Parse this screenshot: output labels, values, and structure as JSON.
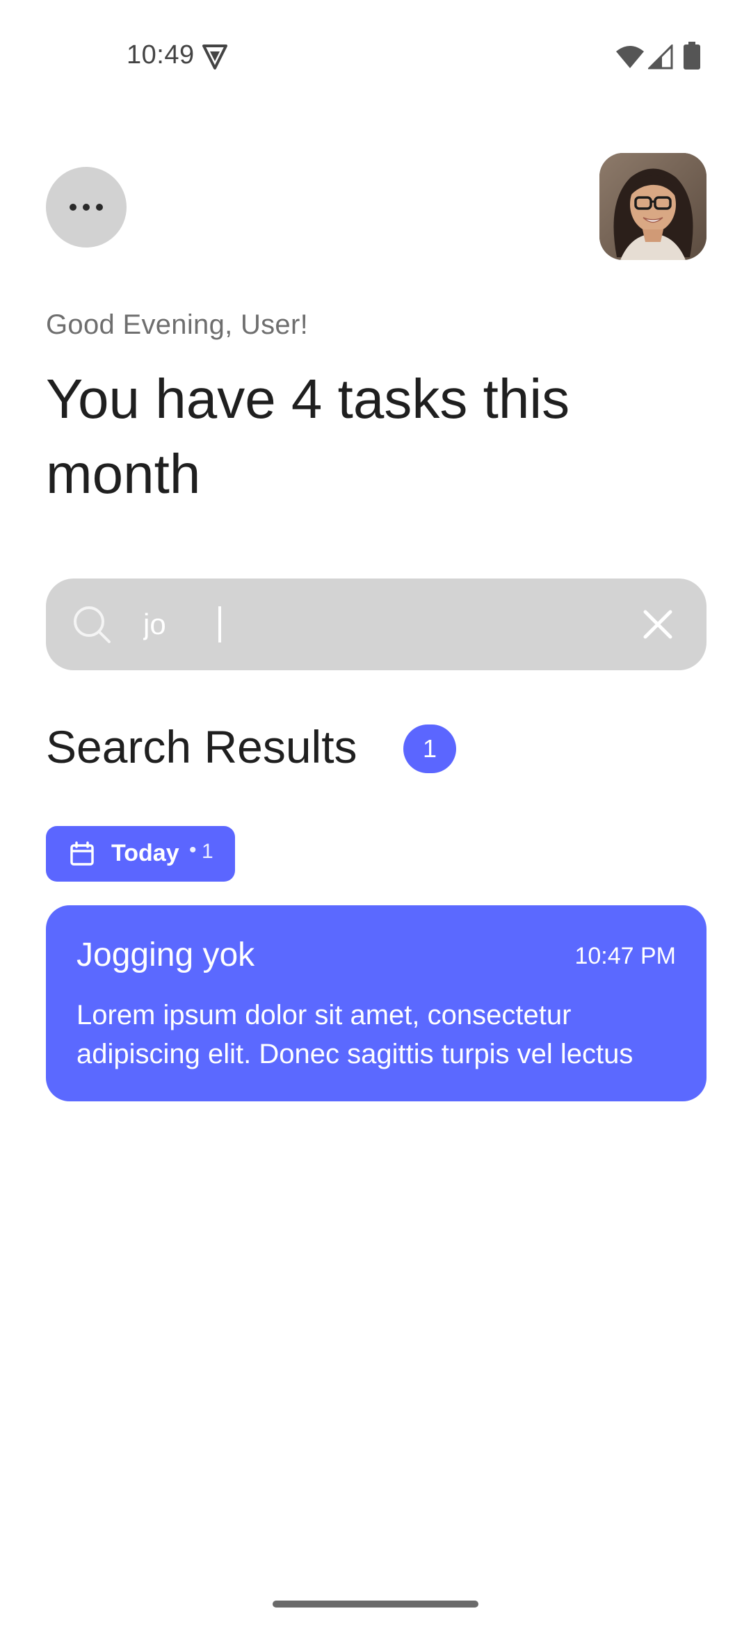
{
  "status_bar": {
    "time": "10:49",
    "icons": [
      "vpn-icon",
      "wifi-icon",
      "signal-icon",
      "battery-icon"
    ]
  },
  "header": {
    "menu_icon": "more-horizontal-icon",
    "avatar": "user-avatar"
  },
  "greeting": "Good Evening, User!",
  "headline": "You have 4 tasks this month",
  "search": {
    "value": "jo",
    "search_icon": "search-icon",
    "clear_icon": "close-icon"
  },
  "results": {
    "title": "Search Results",
    "count": "1"
  },
  "date_group": {
    "icon": "calendar-icon",
    "label": "Today",
    "separator": "•",
    "count": "1"
  },
  "tasks": [
    {
      "title": "Jogging yok",
      "time": "10:47 PM",
      "description": "Lorem ipsum dolor sit amet, consectetur adipiscing elit. Donec sagittis turpis vel lectus"
    }
  ],
  "colors": {
    "accent": "#5b66ff",
    "search_bg": "#d3d3d3",
    "menu_bg": "#d2d2d2"
  }
}
